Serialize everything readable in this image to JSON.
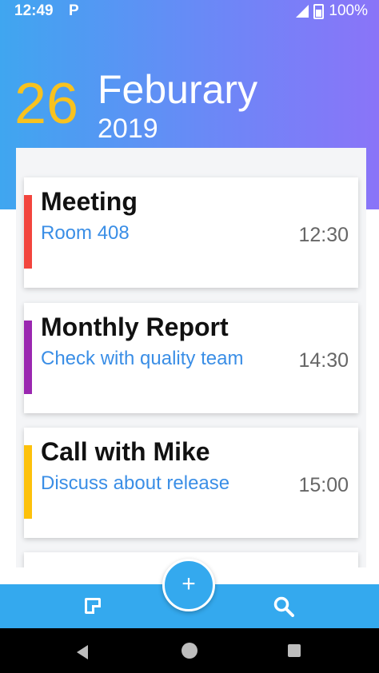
{
  "status_bar": {
    "time": "12:49",
    "carrier_glyph": "P",
    "battery": "100%"
  },
  "date": {
    "day": "26",
    "month": "Feburary",
    "year": "2019"
  },
  "events": [
    {
      "title": "Meeting",
      "subtitle": "Room 408",
      "time": "12:30",
      "color": "#f2453d"
    },
    {
      "title": "Monthly Report",
      "subtitle": "Check with quality team",
      "time": "14:30",
      "color": "#9a27b0"
    },
    {
      "title": "Call with Mike",
      "subtitle": "Discuss about release",
      "time": "15:00",
      "color": "#fdc10b"
    }
  ],
  "fab": {
    "label": "+"
  },
  "colors": {
    "accent": "#34a9ee",
    "day": "#f8c21f",
    "subtitle": "#3a8ee6"
  },
  "icons": [
    "notes-icon",
    "search-icon",
    "add-icon",
    "back-icon",
    "home-icon",
    "recents-icon"
  ]
}
